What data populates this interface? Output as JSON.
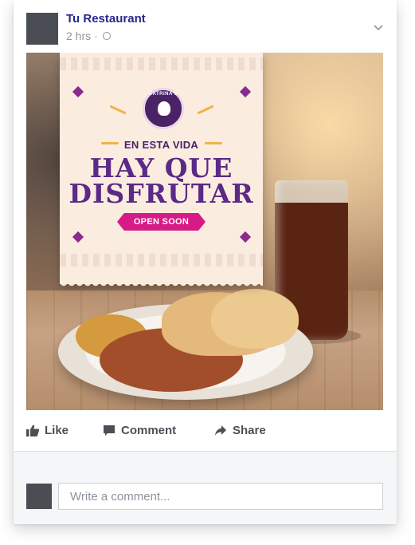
{
  "post": {
    "author": "Tu Restaurant",
    "time": "2 hrs",
    "separator": "·",
    "privacy_icon": "globe-icon",
    "menu_icon": "chevron-down-icon"
  },
  "image": {
    "logo_text": "CATRINA'S",
    "subhead": "EN ESTA VIDA",
    "headline_line1": "HAY QUE",
    "headline_line2": "DISFRUTAR",
    "badge": "OPEN SOON"
  },
  "actions": {
    "like": "Like",
    "comment": "Comment",
    "share": "Share",
    "like_icon": "thumbs-up-icon",
    "comment_icon": "speech-bubble-icon",
    "share_icon": "share-arrow-icon"
  },
  "comment_box": {
    "placeholder": "Write a comment..."
  },
  "colors": {
    "author": "#25288c",
    "muted": "#90949c",
    "action_text": "#4b4f56",
    "banner_purple": "#5a2a86",
    "badge_pink": "#d61b86"
  }
}
